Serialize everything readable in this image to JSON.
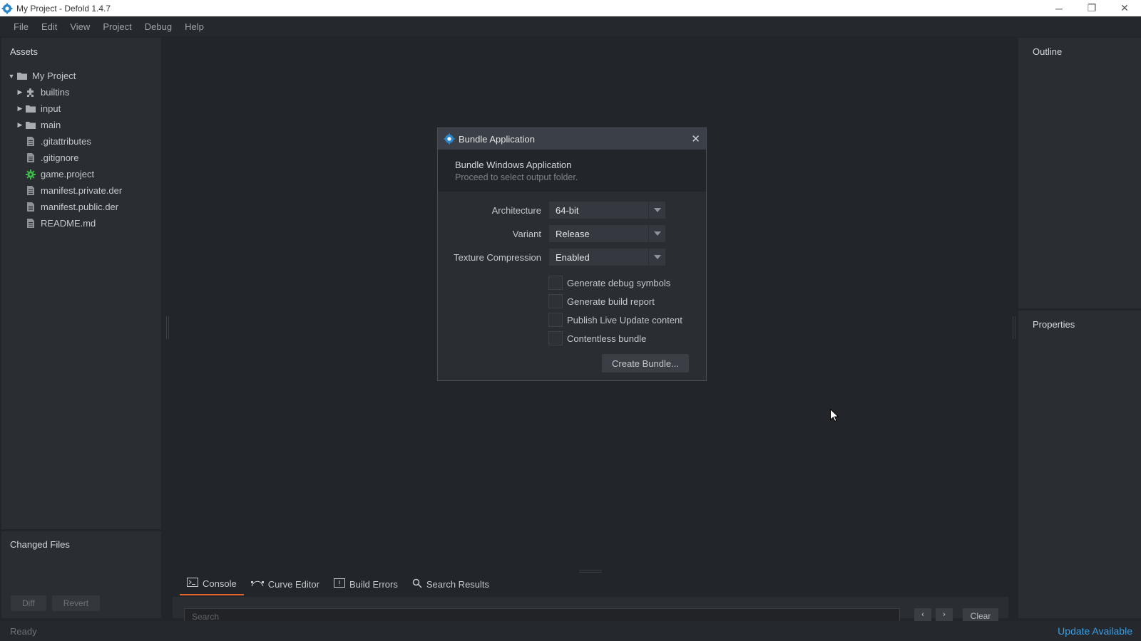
{
  "window": {
    "title": "My Project - Defold 1.4.7",
    "controls": {
      "minimize": "─",
      "restore": "❐",
      "close": "✕"
    }
  },
  "menu": [
    "File",
    "Edit",
    "View",
    "Project",
    "Debug",
    "Help"
  ],
  "assets": {
    "header": "Assets",
    "items": [
      {
        "label": "My Project",
        "icon": "folder-icon",
        "arrow": "▼"
      },
      {
        "label": "builtins",
        "icon": "puzzle-icon",
        "arrow": "▶"
      },
      {
        "label": "input",
        "icon": "folder-icon",
        "arrow": "▶"
      },
      {
        "label": "main",
        "icon": "folder-icon",
        "arrow": "▶"
      },
      {
        "label": ".gitattributes",
        "icon": "file-icon",
        "arrow": ""
      },
      {
        "label": ".gitignore",
        "icon": "file-icon",
        "arrow": ""
      },
      {
        "label": "game.project",
        "icon": "gear-icon",
        "arrow": ""
      },
      {
        "label": "manifest.private.der",
        "icon": "file-icon",
        "arrow": ""
      },
      {
        "label": "manifest.public.der",
        "icon": "file-icon",
        "arrow": ""
      },
      {
        "label": "README.md",
        "icon": "file-icon",
        "arrow": ""
      }
    ]
  },
  "changed_files": {
    "header": "Changed Files",
    "diff_label": "Diff",
    "revert_label": "Revert"
  },
  "outline": {
    "header": "Outline"
  },
  "properties": {
    "header": "Properties"
  },
  "bottom": {
    "tabs": [
      {
        "label": "Console",
        "icon": "terminal-icon"
      },
      {
        "label": "Curve Editor",
        "icon": "curve-icon"
      },
      {
        "label": "Build Errors",
        "icon": "error-icon"
      },
      {
        "label": "Search Results",
        "icon": "search-icon"
      }
    ],
    "active_tab": "Console",
    "search_placeholder": "Search",
    "prev": "‹",
    "next": "›",
    "clear_label": "Clear"
  },
  "status": {
    "text": "Ready",
    "update_label": "Update Available"
  },
  "dialog": {
    "title": "Bundle Application",
    "close": "✕",
    "heading": "Bundle Windows Application",
    "subheading": "Proceed to select output folder.",
    "fields": {
      "architecture": {
        "label": "Architecture",
        "value": "64-bit"
      },
      "variant": {
        "label": "Variant",
        "value": "Release"
      },
      "texture_compression": {
        "label": "Texture Compression",
        "value": "Enabled"
      }
    },
    "checkboxes": [
      {
        "label": "Generate debug symbols",
        "checked": false
      },
      {
        "label": "Generate build report",
        "checked": false
      },
      {
        "label": "Publish Live Update content",
        "checked": false
      },
      {
        "label": "Contentless bundle",
        "checked": false
      }
    ],
    "create_label": "Create Bundle..."
  },
  "colors": {
    "accent": "#e2622b",
    "link": "#3a9ee4",
    "background": "#22252a",
    "panel": "#2a2d32",
    "gear": "#3fb84a"
  }
}
